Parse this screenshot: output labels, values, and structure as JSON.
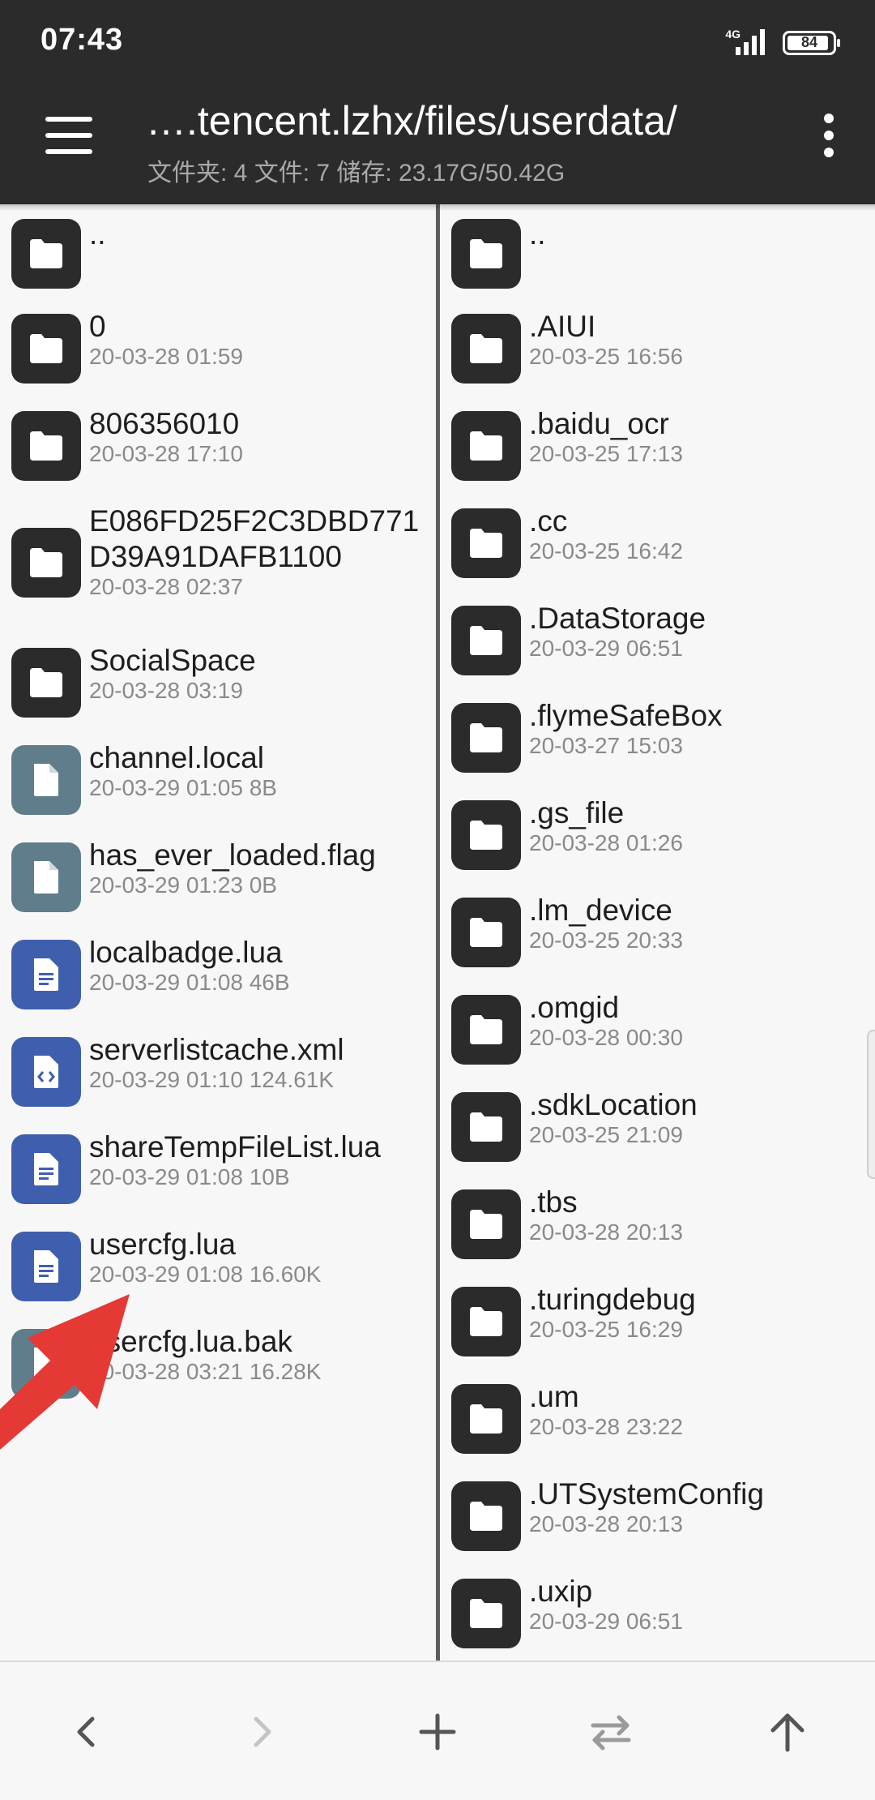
{
  "status_bar": {
    "time": "07:43",
    "network": "4G",
    "battery": "84"
  },
  "toolbar": {
    "path": "….tencent.lzhx/files/userdata/",
    "info": "文件夹: 4  文件: 7  储存: 23.17G/50.42G"
  },
  "left_panel": {
    "items": [
      {
        "name": "..",
        "meta": "",
        "icon": "folder-icon"
      },
      {
        "name": "0",
        "meta": "20-03-28 01:59",
        "icon": "folder-icon"
      },
      {
        "name": "806356010",
        "meta": "20-03-28 17:10",
        "icon": "folder-icon"
      },
      {
        "name": "E086FD25F2C3DBD771",
        "name2": "D39A91DAFB1100",
        "meta": "20-03-28 02:37",
        "icon": "folder-icon"
      },
      {
        "name": "SocialSpace",
        "meta": "20-03-28 03:19",
        "icon": "folder-icon"
      },
      {
        "name": "channel.local",
        "meta": "20-03-29 01:05  8B",
        "icon": "file-icon"
      },
      {
        "name": "has_ever_loaded.flag",
        "meta": "20-03-29 01:23  0B",
        "icon": "file-icon"
      },
      {
        "name": "localbadge.lua",
        "meta": "20-03-29 01:08  46B",
        "icon": "text-file-icon"
      },
      {
        "name": "serverlistcache.xml",
        "meta": "20-03-29 01:10  124.61K",
        "icon": "code-file-icon"
      },
      {
        "name": "shareTempFileList.lua",
        "meta": "20-03-29 01:08  10B",
        "icon": "text-file-icon"
      },
      {
        "name": "usercfg.lua",
        "meta": "20-03-29 01:08  16.60K",
        "icon": "text-file-icon"
      },
      {
        "name": "usercfg.lua.bak",
        "meta": "20-03-28 03:21  16.28K",
        "icon": "file-icon"
      }
    ]
  },
  "right_panel": {
    "items": [
      {
        "name": "..",
        "meta": ""
      },
      {
        "name": ".AIUI",
        "meta": "20-03-25 16:56"
      },
      {
        "name": ".baidu_ocr",
        "meta": "20-03-25 17:13"
      },
      {
        "name": ".cc",
        "meta": "20-03-25 16:42"
      },
      {
        "name": ".DataStorage",
        "meta": "20-03-29 06:51"
      },
      {
        "name": ".flymeSafeBox",
        "meta": "20-03-27 15:03"
      },
      {
        "name": ".gs_file",
        "meta": "20-03-28 01:26"
      },
      {
        "name": ".lm_device",
        "meta": "20-03-25 20:33"
      },
      {
        "name": ".omgid",
        "meta": "20-03-28 00:30"
      },
      {
        "name": ".sdkLocation",
        "meta": "20-03-25 21:09"
      },
      {
        "name": ".tbs",
        "meta": "20-03-28 20:13"
      },
      {
        "name": ".turingdebug",
        "meta": "20-03-25 16:29"
      },
      {
        "name": ".um",
        "meta": "20-03-28 23:22"
      },
      {
        "name": ".UTSystemConfig",
        "meta": "20-03-28 20:13"
      },
      {
        "name": ".uxip",
        "meta": "20-03-29 06:51"
      }
    ]
  },
  "colors": {
    "bar": "#2b2b2b",
    "folder_icon": "#2b2b2b",
    "file_icon": "#607d8b",
    "doc_icon": "#3f5fae",
    "annotation_arrow": "#e53935"
  },
  "bottom_bar": {
    "buttons": [
      "chevron-left-icon",
      "chevron-right-icon",
      "plus-icon",
      "swap-icon",
      "arrow-up-icon"
    ]
  }
}
